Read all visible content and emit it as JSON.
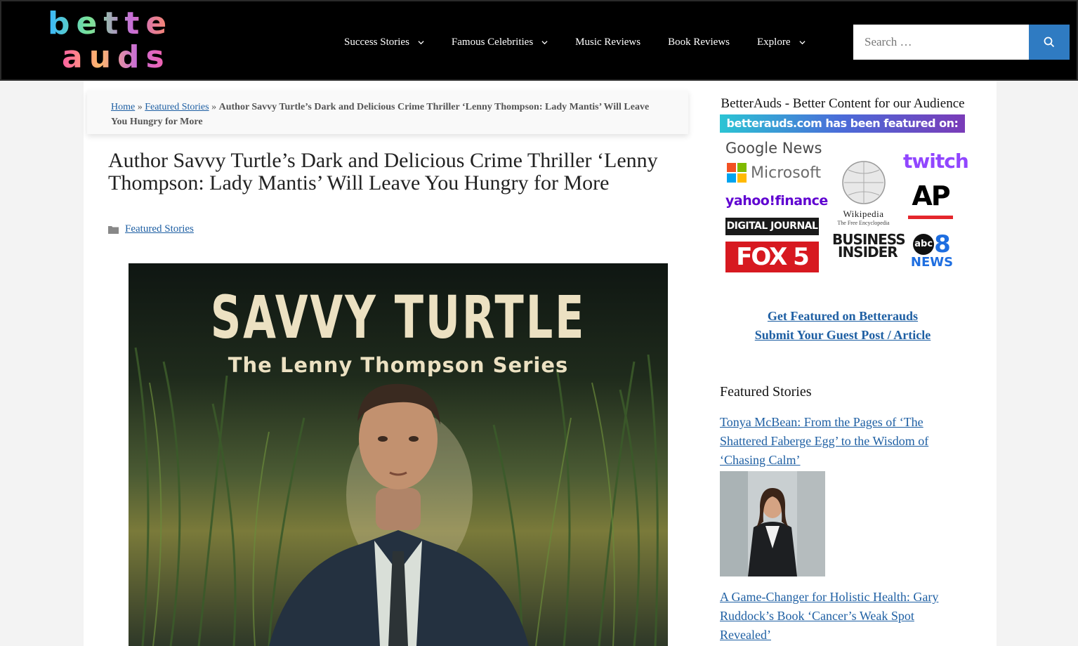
{
  "header": {
    "logo_line1": "better",
    "logo_line2": "auds",
    "nav": [
      {
        "label": "Success Stories",
        "dropdown": true
      },
      {
        "label": "Famous Celebrities",
        "dropdown": true
      },
      {
        "label": "Music Reviews",
        "dropdown": false
      },
      {
        "label": "Book Reviews",
        "dropdown": false
      },
      {
        "label": "Explore",
        "dropdown": true
      }
    ],
    "search_placeholder": "Search …"
  },
  "breadcrumb": {
    "home": "Home",
    "sep1": " » ",
    "category": "Featured Stories",
    "sep2": " » ",
    "current": "Author Savvy Turtle’s Dark and Delicious Crime Thriller ‘Lenny Thompson: Lady Mantis’ Will Leave You Hungry for More"
  },
  "article": {
    "title": "Author Savvy Turtle’s Dark and Delicious Crime Thriller ‘Lenny Thompson: Lady Mantis’ Will Leave You Hungry for More",
    "category": "Featured Stories",
    "cover_title": "SAVVY TURTLE",
    "cover_subtitle": "The Lenny Thompson Series"
  },
  "sidebar": {
    "widget_title": "BetterAuds - Better Content for our Audience",
    "featured_banner": "betterauds.com has been featured on:",
    "featured_logos": {
      "google_news": "Google News",
      "microsoft": "Microsoft",
      "yahoo_finance": "yahoo!finance",
      "digital_journal": "DIGITAL JOURNAL",
      "fox5": "FOX 5",
      "wikipedia": "Wikipedia",
      "wikipedia_sub": "The Free Encyclopedia",
      "business_insider_1": "BUSINESS",
      "business_insider_2": "INSIDER",
      "twitch": "twitch",
      "ap": "AP",
      "abc": "abc",
      "abc_num": "8",
      "news": "NEWS"
    },
    "link_featured": "Get Featured on Betterauds",
    "link_guest": "Submit Your Guest Post / Article",
    "featured_stories_title": "Featured Stories",
    "stories": [
      {
        "title": "Tonya McBean: From the Pages of ‘The Shattered Faberge Egg’ to the Wisdom of ‘Chasing Calm’"
      },
      {
        "title": "A Game-Changer for Holistic Health: Gary Ruddock’s Book ‘Cancer’s Weak Spot Revealed’"
      }
    ]
  },
  "colors": {
    "header_bg": "#000000",
    "link": "#1e5fa3",
    "search_button": "#2f7bc2"
  }
}
